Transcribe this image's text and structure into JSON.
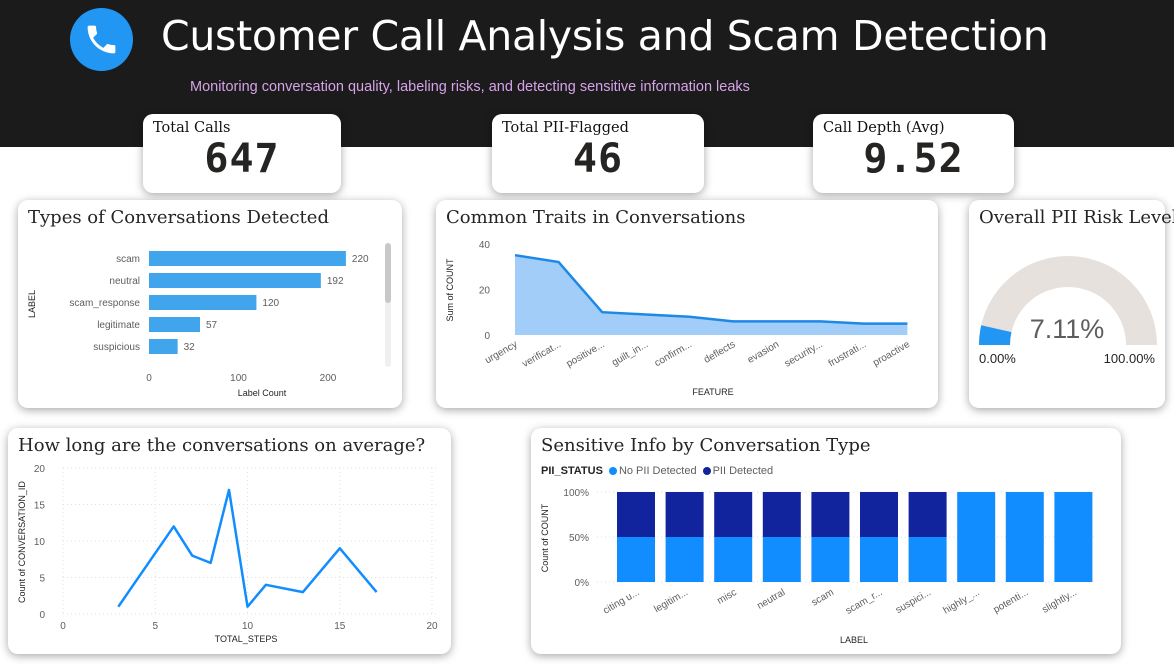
{
  "header": {
    "title": "Customer Call Analysis and Scam Detection",
    "subtitle": "Monitoring conversation quality, labeling risks, and detecting sensitive information leaks",
    "icon": "phone-icon"
  },
  "colors": {
    "primary_blue": "#2196f3",
    "bar_blue": "#41a5ee",
    "area_fill": "#a3cdf9",
    "line_blue": "#1e88e5",
    "pii_dark": "#12239e",
    "no_pii": "#118dff",
    "gauge_track": "#e6e1dc",
    "header_bg": "#1b1b1b",
    "subtitle": "#d6a2e8"
  },
  "kpis": [
    {
      "label": "Total Calls",
      "value": "647"
    },
    {
      "label": "Total PII-Flagged",
      "value": "46"
    },
    {
      "label": "Call Depth (Avg)",
      "value": "9.52"
    }
  ],
  "charts": {
    "types": {
      "title": "Types of Conversations Detected",
      "ylabel": "LABEL",
      "xlabel": "Label Count",
      "xticks": [
        "0",
        "100",
        "200"
      ]
    },
    "traits": {
      "title": "Common Traits in Conversations",
      "ylabel": "Sum of COUNT",
      "xlabel": "FEATURE",
      "yticks": [
        "0",
        "20",
        "40"
      ]
    },
    "gauge": {
      "title": "Overall PII Risk Level",
      "value_label": "7.11%",
      "min_label": "0.00%",
      "max_label": "100.00%"
    },
    "length": {
      "title": "How long are the conversations on average?",
      "ylabel": "Count of CONVERSATION_ID",
      "xlabel": "TOTAL_STEPS",
      "xticks": [
        "0",
        "5",
        "10",
        "15",
        "20"
      ],
      "yticks": [
        "0",
        "5",
        "10",
        "15",
        "20"
      ]
    },
    "sensitive": {
      "title": "Sensitive Info by Conversation Type",
      "legend_title": "PII_STATUS",
      "legend_no": "No PII Detected",
      "legend_yes": "PII Detected",
      "ylabel": "Count of COUNT",
      "xlabel": "LABEL",
      "yticks": [
        "0%",
        "50%",
        "100%"
      ]
    }
  },
  "chart_data": [
    {
      "type": "bar",
      "orientation": "horizontal",
      "categories": [
        "scam",
        "neutral",
        "scam_response",
        "legitimate",
        "suspicious"
      ],
      "values": [
        220,
        192,
        120,
        57,
        32
      ],
      "xlim": [
        0,
        230
      ]
    },
    {
      "type": "area",
      "categories": [
        "urgency",
        "verificat...",
        "positive...",
        "guilt_in...",
        "confirm...",
        "deflects",
        "evasion",
        "security...",
        "frustrati...",
        "proactive"
      ],
      "values": [
        35,
        32,
        10,
        9,
        8,
        6,
        6,
        6,
        5,
        5
      ],
      "ylim": [
        0,
        40
      ]
    },
    {
      "type": "gauge",
      "value": 7.11,
      "min": 0,
      "max": 100
    },
    {
      "type": "line",
      "x": [
        3,
        6,
        7,
        8,
        9,
        10,
        11,
        13,
        15,
        17
      ],
      "y": [
        1,
        12,
        8,
        7,
        17,
        1,
        4,
        3,
        9,
        3
      ],
      "xlim": [
        0,
        20
      ],
      "ylim": [
        0,
        20
      ]
    },
    {
      "type": "bar",
      "stacked": "100%",
      "categories": [
        "citing u...",
        "legitim...",
        "misc",
        "neutral",
        "scam",
        "scam_r...",
        "suspici...",
        "highly_...",
        "potenti...",
        "slightly..."
      ],
      "series": [
        {
          "name": "No PII Detected",
          "values": [
            50,
            50,
            50,
            50,
            50,
            50,
            50,
            100,
            100,
            100
          ]
        },
        {
          "name": "PII Detected",
          "values": [
            50,
            50,
            50,
            50,
            50,
            50,
            50,
            0,
            0,
            0
          ]
        }
      ]
    }
  ]
}
